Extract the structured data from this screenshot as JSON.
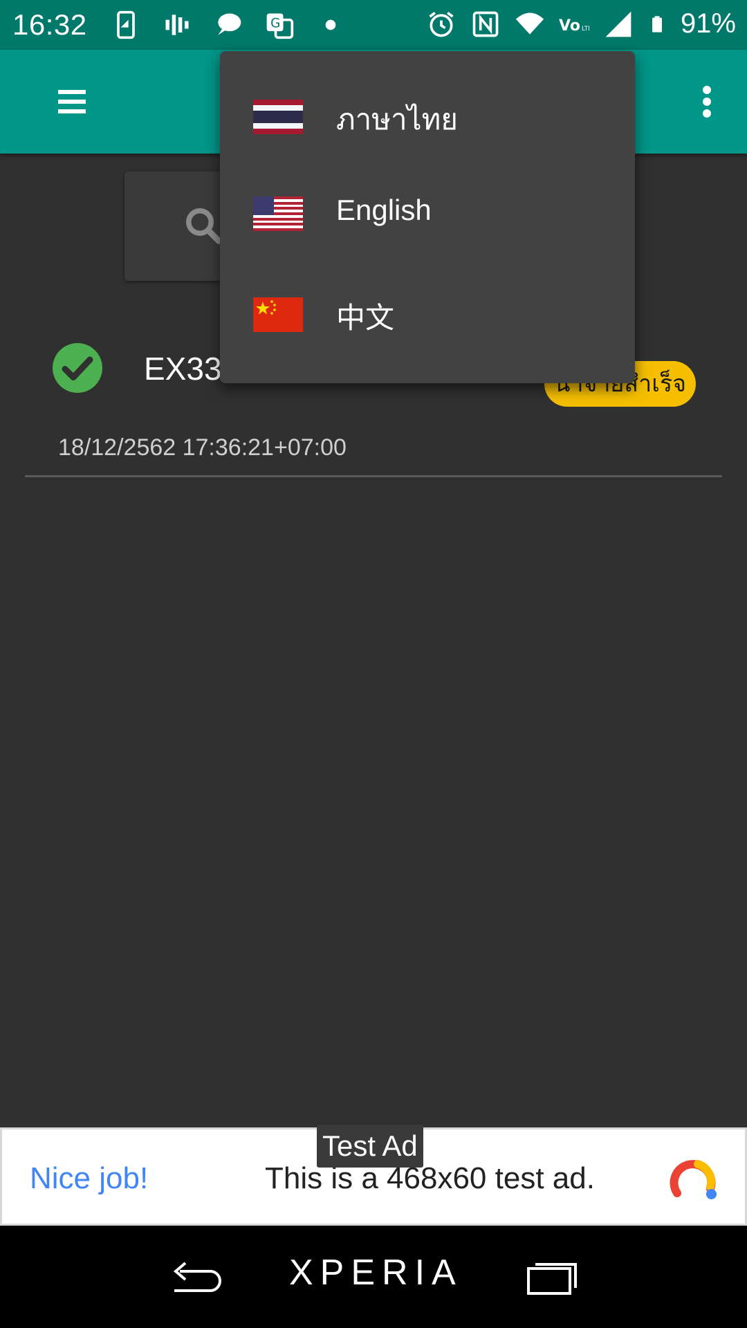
{
  "status_bar": {
    "time": "16:32",
    "battery_percent": "91%",
    "icons_left": [
      "screenshot-icon",
      "equalizer-icon",
      "chat-bubble-icon",
      "translate-icon",
      "dot-icon"
    ],
    "icons_right": [
      "alarm-icon",
      "nfc-icon",
      "wifi-icon",
      "volte-icon",
      "cell-signal-icon",
      "battery-icon"
    ]
  },
  "app_bar": {
    "color": "#009688",
    "menu_icon": "hamburger-menu-icon",
    "overflow_icon": "more-vert-icon"
  },
  "search": {
    "icon": "search-icon"
  },
  "list": {
    "items": [
      {
        "title": "EX33",
        "status_badge": "นำจ่ายสำเร็จ",
        "datetime": "18/12/2562 17:36:21+07:00",
        "status_icon": "check-circle-icon",
        "badge_color": "#f5bf00"
      }
    ]
  },
  "language_menu": {
    "items": [
      {
        "label": "ภาษาไทย",
        "flag": "thailand-flag-icon"
      },
      {
        "label": "English",
        "flag": "usa-flag-icon"
      },
      {
        "label": "中文",
        "flag": "china-flag-icon"
      }
    ]
  },
  "ad": {
    "label": "Test Ad",
    "headline": "Nice job!",
    "body": "This is a 468x60 test ad.",
    "logo": "admob-logo-icon"
  },
  "nav_bar": {
    "brand": "XPERIA",
    "back_icon": "back-icon",
    "recent_icon": "recent-apps-icon"
  }
}
